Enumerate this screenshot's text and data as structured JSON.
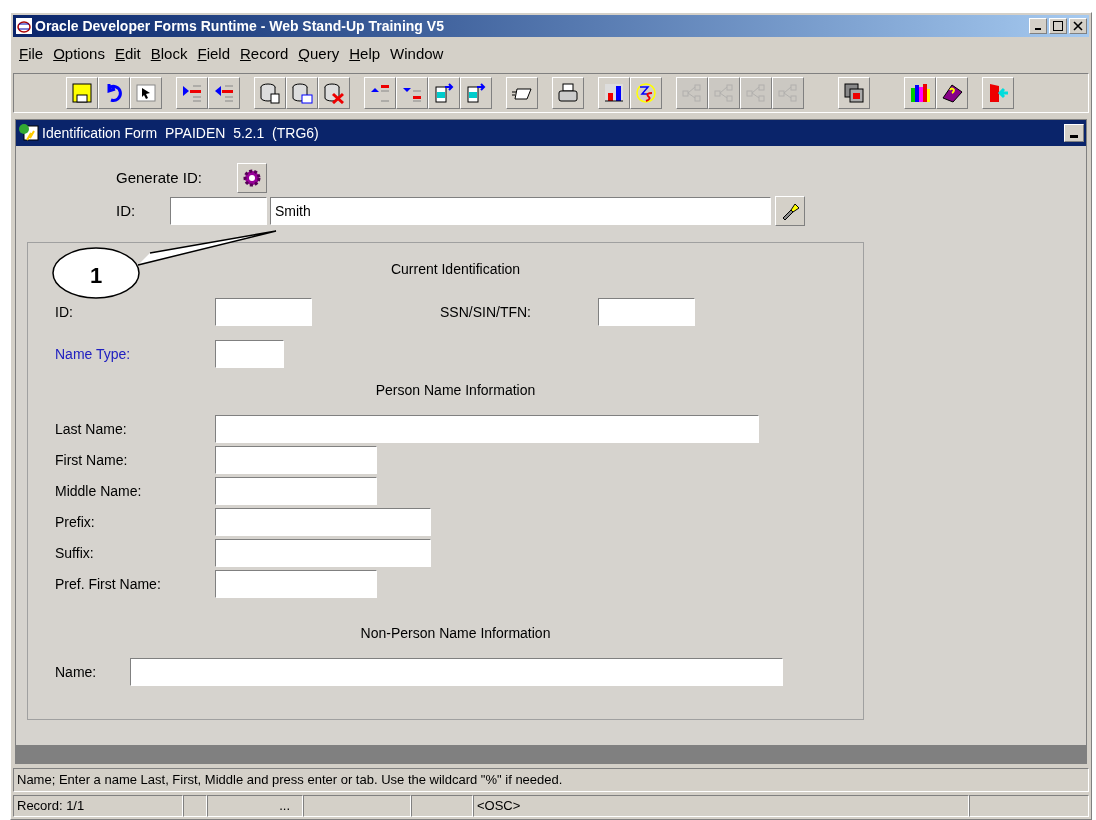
{
  "window": {
    "title": "Oracle Developer Forms Runtime - Web Stand-Up Training V5"
  },
  "menu": [
    {
      "label": "File",
      "mnemonic": true
    },
    {
      "label": "Options",
      "mnemonic": true
    },
    {
      "label": "Edit",
      "mnemonic": true
    },
    {
      "label": "Block",
      "mnemonic": true
    },
    {
      "label": "Field",
      "mnemonic": true
    },
    {
      "label": "Record",
      "mnemonic": true
    },
    {
      "label": "Query",
      "mnemonic": true
    },
    {
      "label": "Help",
      "mnemonic": true
    },
    {
      "label": "Window",
      "mnemonic": false
    }
  ],
  "toolbar": [
    [
      {
        "kind": "save",
        "disabled": false
      },
      {
        "kind": "undo",
        "disabled": false
      },
      {
        "kind": "select",
        "disabled": false
      }
    ],
    [
      {
        "kind": "next-block",
        "disabled": false
      },
      {
        "kind": "prev-block",
        "disabled": false
      }
    ],
    [
      {
        "kind": "enter-query",
        "disabled": false
      },
      {
        "kind": "execute-query",
        "disabled": false
      },
      {
        "kind": "cancel-query",
        "disabled": false
      }
    ],
    [
      {
        "kind": "prev-record",
        "disabled": false
      },
      {
        "kind": "next-record",
        "disabled": false
      },
      {
        "kind": "insert-record",
        "disabled": false
      },
      {
        "kind": "remove-record",
        "disabled": false
      }
    ],
    [
      {
        "kind": "envelope",
        "disabled": false
      }
    ],
    [
      {
        "kind": "print",
        "disabled": false
      }
    ],
    [
      {
        "kind": "chart",
        "disabled": false
      },
      {
        "kind": "extension",
        "disabled": false
      }
    ],
    [
      {
        "kind": "tree",
        "disabled": true
      },
      {
        "kind": "tree",
        "disabled": true
      },
      {
        "kind": "tree",
        "disabled": true
      },
      {
        "kind": "tree",
        "disabled": true
      }
    ],
    [
      {
        "kind": "window",
        "disabled": false
      }
    ],
    [
      {
        "kind": "books",
        "disabled": false
      },
      {
        "kind": "help",
        "disabled": false
      }
    ],
    [
      {
        "kind": "exit",
        "disabled": false
      }
    ]
  ],
  "form": {
    "title": "Identification Form  PPAIDEN  5.2.1  (TRG6)",
    "generate_id": {
      "label": "Generate ID:"
    },
    "id": {
      "label": "ID:",
      "name_value": "Smith"
    },
    "callout": {
      "label": "1"
    },
    "sections": [
      {
        "heading": "Current Identification",
        "kind": "current",
        "fields": [
          {
            "label": "ID:",
            "link": false
          },
          {
            "label": "SSN/SIN/TFN:",
            "link": false
          },
          {
            "label": "Name Type:",
            "link": true
          }
        ]
      },
      {
        "heading": "Person Name Information",
        "kind": "person",
        "fields": [
          {
            "label": "Last Name:",
            "link": false
          },
          {
            "label": "First Name:",
            "link": false
          },
          {
            "label": "Middle Name:",
            "link": false
          },
          {
            "label": "Prefix:",
            "link": false
          },
          {
            "label": "Suffix:",
            "link": false
          },
          {
            "label": "Pref. First Name:",
            "link": false
          }
        ]
      },
      {
        "heading": "Non-Person Name Information",
        "kind": "nonperson",
        "fields": [
          {
            "label": "Name:",
            "link": false
          }
        ]
      }
    ]
  },
  "hint": "Name; Enter a name Last, First, Middle and press enter or tab. Use the wildcard \"%\" if needed.",
  "status_bar": {
    "record": "Record: 1/1",
    "ellipsis": "...",
    "mode": "<OSC>"
  }
}
